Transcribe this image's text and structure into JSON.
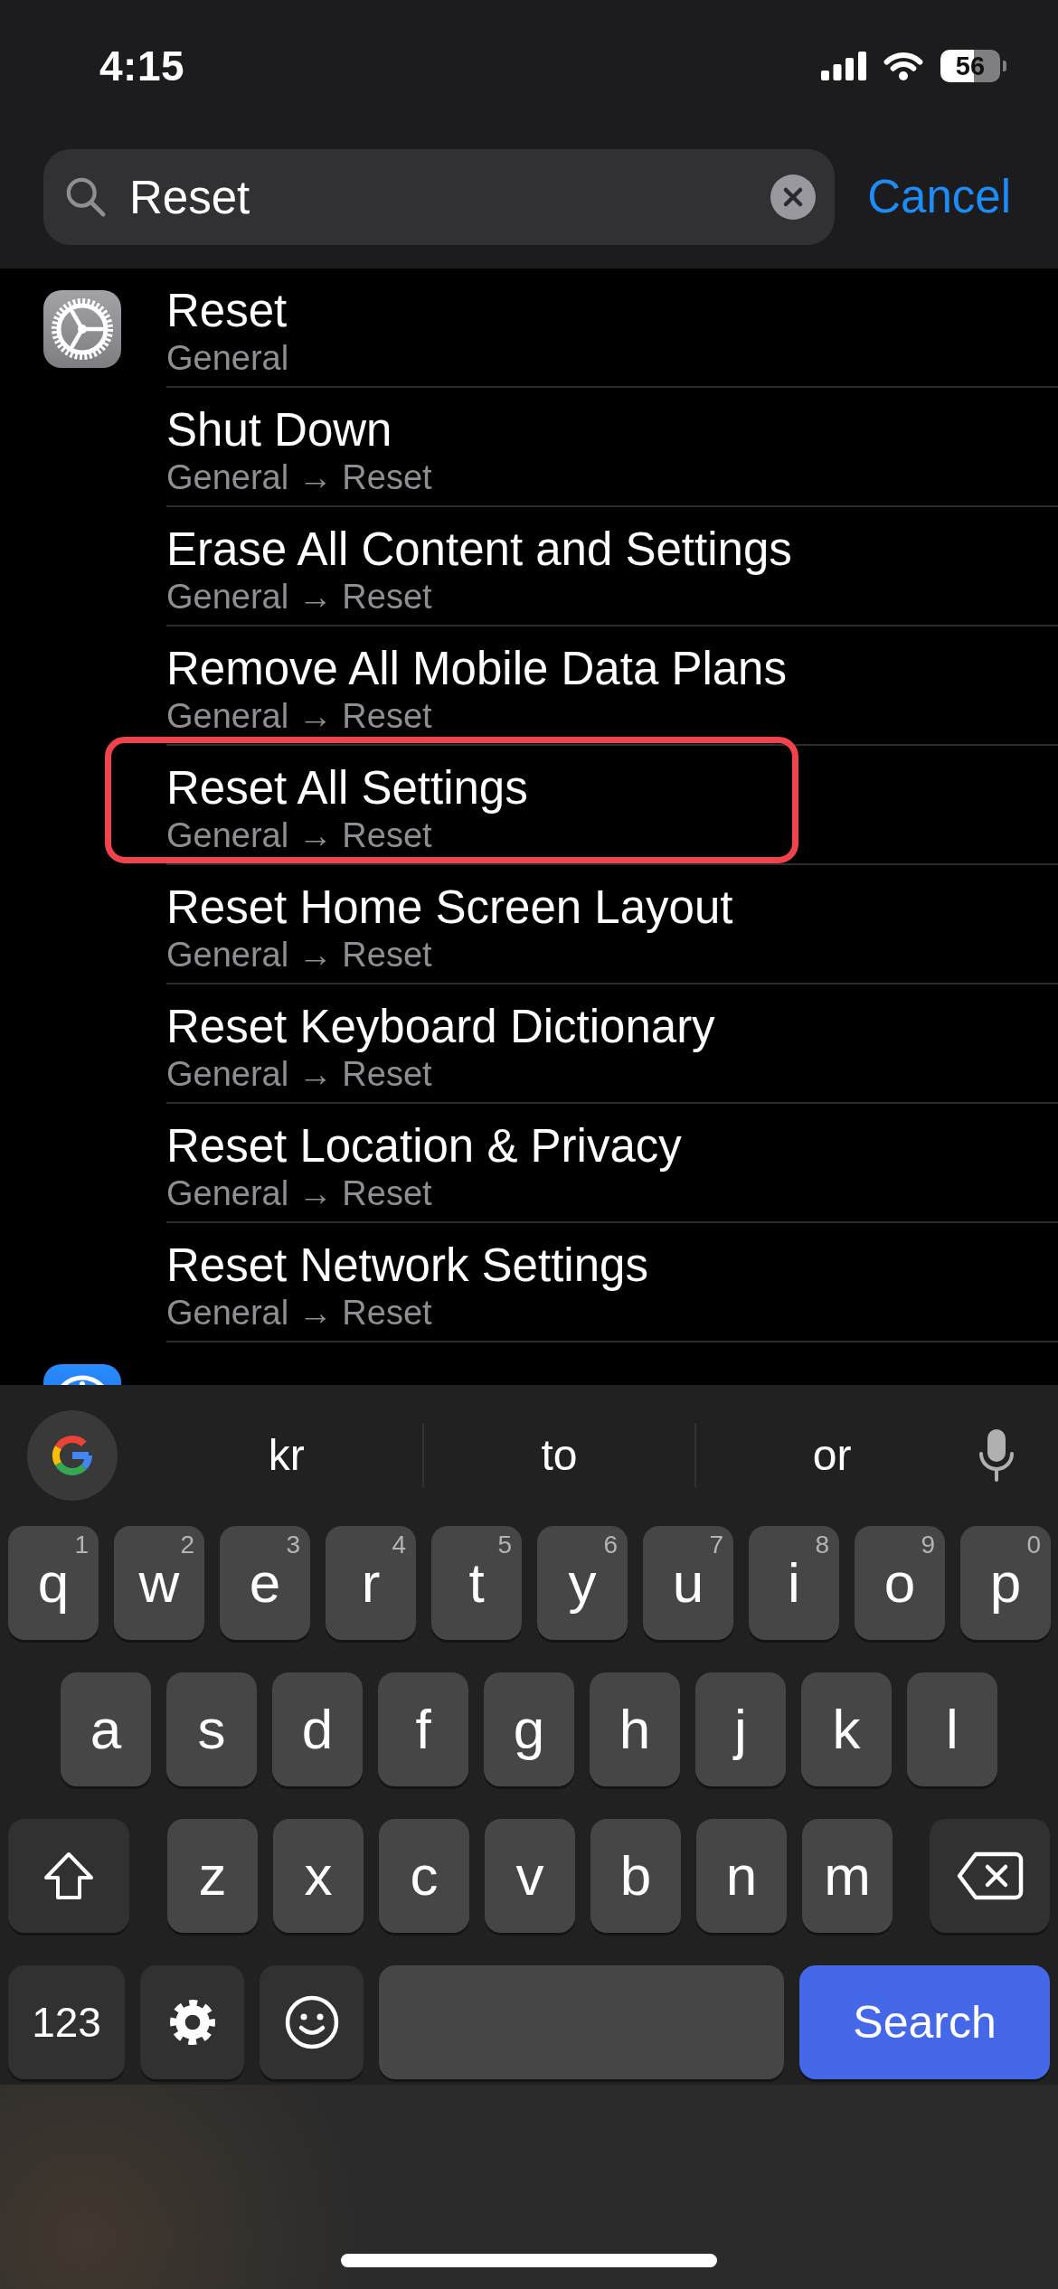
{
  "status_bar": {
    "time": "4:15",
    "battery": "56"
  },
  "search": {
    "value": "Reset",
    "cancel": "Cancel"
  },
  "sections": [
    {
      "kind": "settings",
      "results": [
        {
          "title": "Reset",
          "path": "General",
          "highlighted": false
        },
        {
          "title": "Shut Down",
          "path": "General → Reset",
          "highlighted": false
        },
        {
          "title": "Erase All Content and Settings",
          "path": "General → Reset",
          "highlighted": false
        },
        {
          "title": "Remove All Mobile Data Plans",
          "path": "General → Reset",
          "highlighted": false
        },
        {
          "title": "Reset All Settings",
          "path": "General → Reset",
          "highlighted": true
        },
        {
          "title": "Reset Home Screen Layout",
          "path": "General → Reset",
          "highlighted": false
        },
        {
          "title": "Reset Keyboard Dictionary",
          "path": "General → Reset",
          "highlighted": false
        },
        {
          "title": "Reset Location & Privacy",
          "path": "General → Reset",
          "highlighted": false
        },
        {
          "title": "Reset Network Settings",
          "path": "General → Reset",
          "highlighted": false
        }
      ]
    },
    {
      "kind": "app"
    }
  ],
  "keyboard": {
    "suggestions": [
      "kr",
      "to",
      "or"
    ],
    "top_row": [
      {
        "kind": "letter",
        "label": "q",
        "hint": "1"
      },
      {
        "kind": "letter",
        "label": "w",
        "hint": "2"
      },
      {
        "kind": "letter",
        "label": "e",
        "hint": "3"
      },
      {
        "kind": "letter",
        "label": "r",
        "hint": "4"
      },
      {
        "kind": "letter",
        "label": "t",
        "hint": "5"
      },
      {
        "kind": "letter",
        "label": "y",
        "hint": "6"
      },
      {
        "kind": "letter",
        "label": "u",
        "hint": "7"
      },
      {
        "kind": "letter",
        "label": "i",
        "hint": "8"
      },
      {
        "kind": "letter",
        "label": "o",
        "hint": "9"
      },
      {
        "kind": "letter",
        "label": "p",
        "hint": "0"
      }
    ],
    "middle_row": [
      {
        "kind": "letter",
        "label": "a"
      },
      {
        "kind": "letter",
        "label": "s"
      },
      {
        "kind": "letter",
        "label": "d"
      },
      {
        "kind": "letter",
        "label": "f"
      },
      {
        "kind": "letter",
        "label": "g"
      },
      {
        "kind": "letter",
        "label": "h"
      },
      {
        "kind": "letter",
        "label": "j"
      },
      {
        "kind": "letter",
        "label": "k"
      },
      {
        "kind": "letter",
        "label": "l"
      }
    ],
    "bottom_row": [
      {
        "kind": "shift"
      },
      {
        "kind": "letter",
        "label": "z"
      },
      {
        "kind": "letter",
        "label": "x"
      },
      {
        "kind": "letter",
        "label": "c"
      },
      {
        "kind": "letter",
        "label": "v"
      },
      {
        "kind": "letter",
        "label": "b"
      },
      {
        "kind": "letter",
        "label": "n"
      },
      {
        "kind": "letter",
        "label": "m"
      },
      {
        "kind": "backspace"
      }
    ],
    "function_row": [
      {
        "kind": "mode",
        "label": "123"
      },
      {
        "kind": "settings"
      },
      {
        "kind": "emoji"
      },
      {
        "kind": "space"
      },
      {
        "kind": "action",
        "label": "Search"
      }
    ]
  }
}
